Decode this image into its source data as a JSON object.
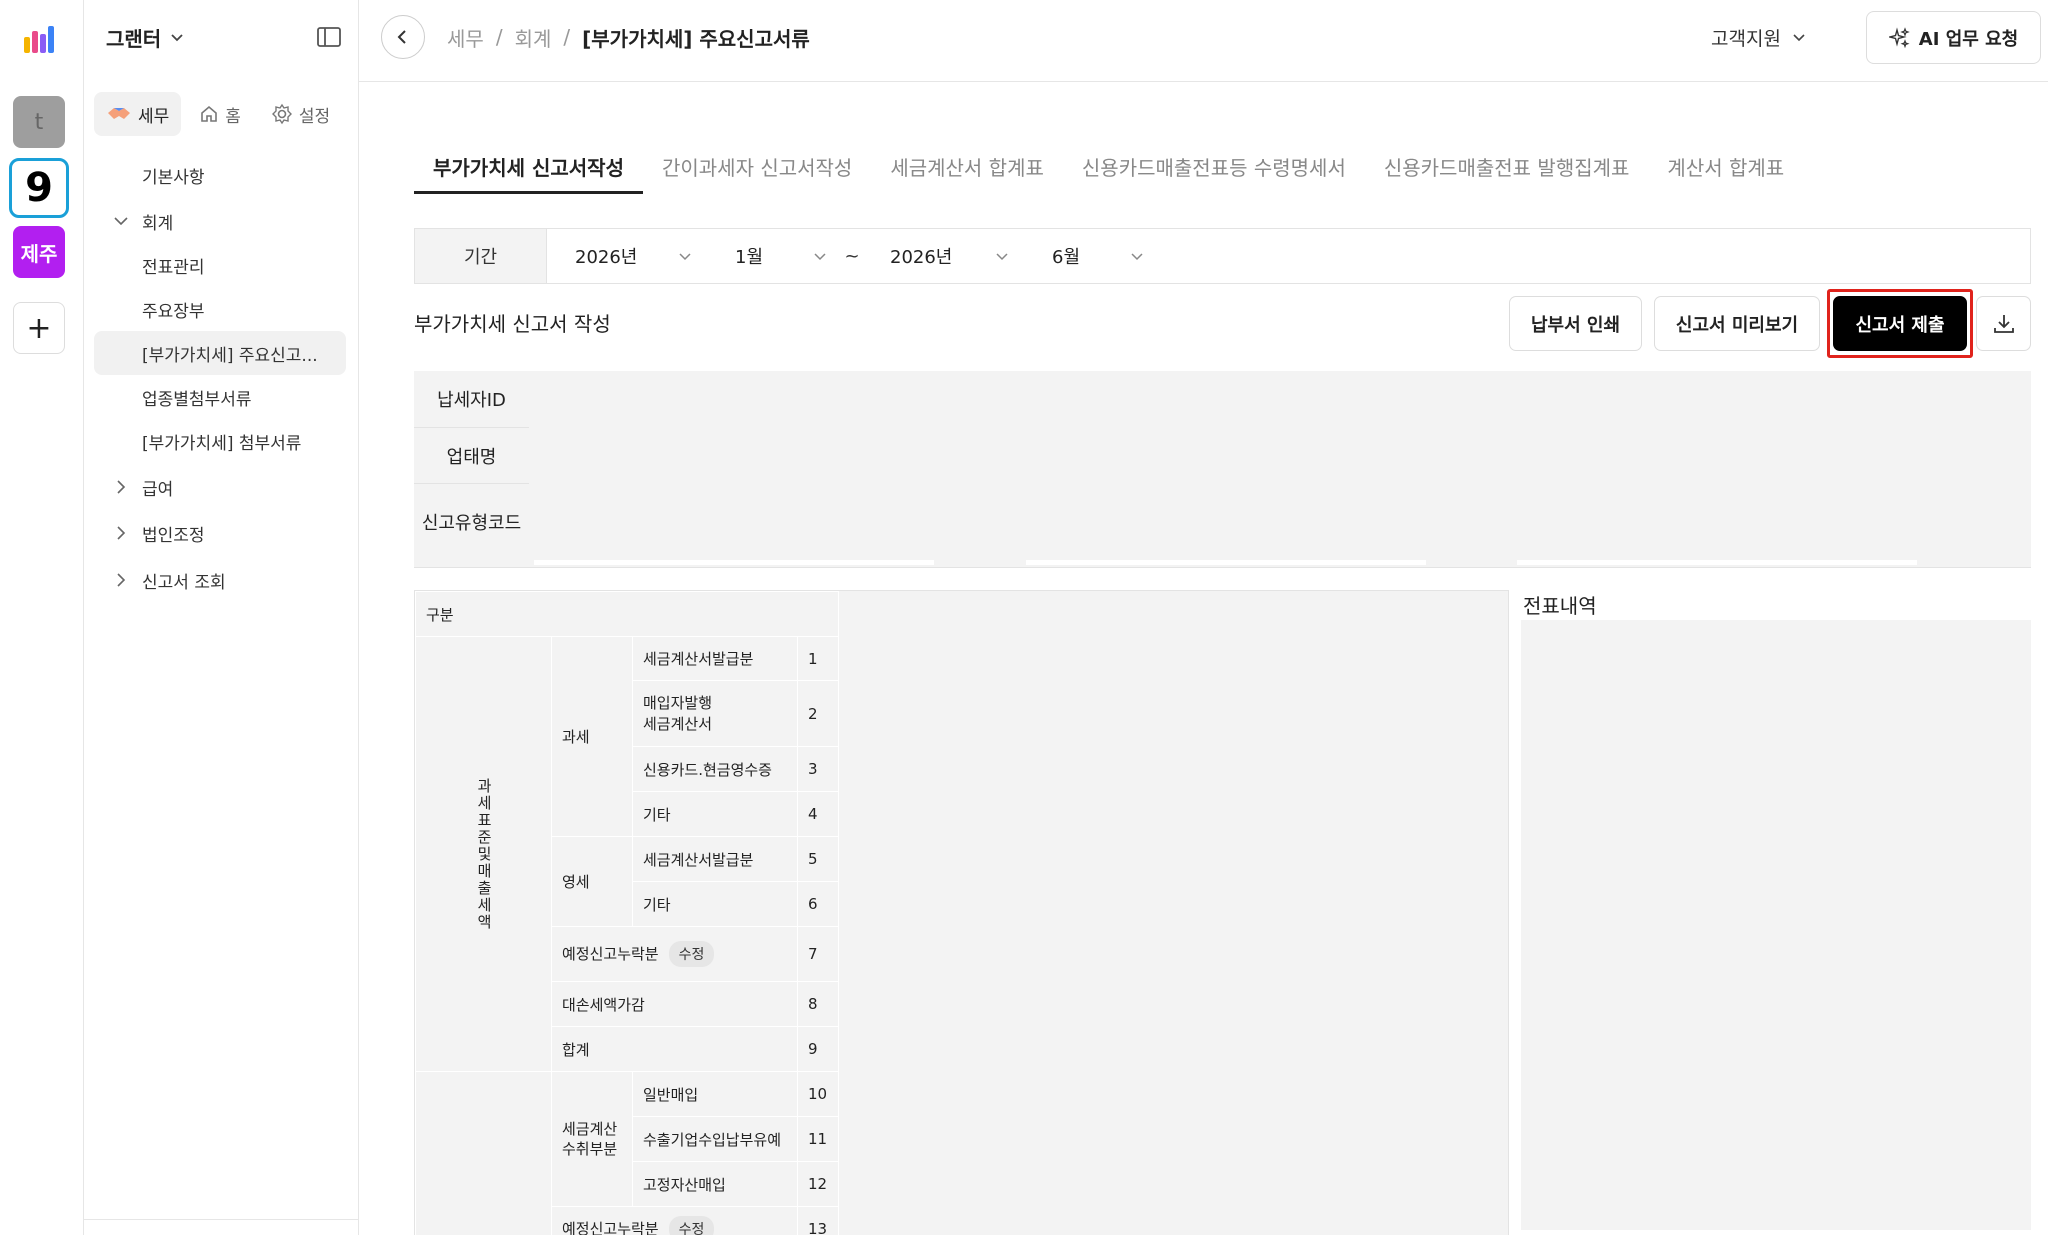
{
  "rail": {
    "tiles": [
      {
        "label": "t"
      },
      {
        "label": "9"
      },
      {
        "label": "제주"
      }
    ],
    "add": "+"
  },
  "sidebar": {
    "company": "그랜터",
    "pills": [
      {
        "label": "세무",
        "icon": "handshake-icon"
      },
      {
        "label": "홈",
        "icon": "home-icon"
      },
      {
        "label": "설정",
        "icon": "gear-icon"
      }
    ],
    "items": [
      {
        "label": "기본사항"
      },
      {
        "label": "회계"
      },
      {
        "label": "전표관리"
      },
      {
        "label": "주요장부"
      },
      {
        "label": "[부가가치세] 주요신고..."
      },
      {
        "label": "업종별첨부서류"
      },
      {
        "label": "[부가가치세] 첨부서류"
      },
      {
        "label": "급여"
      },
      {
        "label": "법인조정"
      },
      {
        "label": "신고서 조회"
      }
    ]
  },
  "header": {
    "breadcrumb": [
      "세무",
      "/",
      "회계",
      "/",
      "[부가가치세] 주요신고서류"
    ],
    "support": "고객지원",
    "ai_button": "AI 업무 요청"
  },
  "tabs": [
    {
      "label": "부가가치세 신고서작성"
    },
    {
      "label": "간이과세자 신고서작성"
    },
    {
      "label": "세금계산서 합계표"
    },
    {
      "label": "신용카드매출전표등 수령명세서"
    },
    {
      "label": "신용카드매출전표 발행집계표"
    },
    {
      "label": "계산서 합계표"
    }
  ],
  "period": {
    "label": "기간",
    "from_year": "2026년",
    "from_month": "1월",
    "separator": "~",
    "to_year": "2026년",
    "to_month": "6월"
  },
  "section": {
    "title": "부가가치세 신고서 작성",
    "buttons": {
      "print": "납부서 인쇄",
      "preview": "신고서 미리보기",
      "submit": "신고서 제출"
    }
  },
  "info_labels": [
    "납세자ID",
    "업태명",
    "신고유형코드"
  ],
  "vat_table": {
    "header": "구분",
    "group1": "과세표준및매출세액",
    "sub_taxable": "과세",
    "sub_zero": "영세",
    "rows": [
      {
        "label": "세금계산서발급분",
        "num": "1"
      },
      {
        "label": "매입자발행\n세금계산서",
        "num": "2"
      },
      {
        "label": "신용카드.현금영수증",
        "num": "3"
      },
      {
        "label": "기타",
        "num": "4"
      },
      {
        "label": "세금계산서발급분",
        "num": "5"
      },
      {
        "label": "기타",
        "num": "6"
      },
      {
        "label": "예정신고누락분",
        "num": "7",
        "badge": "수정"
      },
      {
        "label": "대손세액가감",
        "num": "8"
      },
      {
        "label": "합계",
        "num": "9"
      },
      {
        "label": "일반매입",
        "num": "10"
      },
      {
        "label": "수출기업수입납부유예",
        "num": "11"
      },
      {
        "label": "고정자산매입",
        "num": "12"
      },
      {
        "label": "예정신고누락분",
        "num": "13",
        "badge": "수정"
      }
    ],
    "sub_invoice": "세금계산\n수취부분"
  },
  "journal": {
    "title": "전표내역"
  },
  "colors": {
    "accent": "#000000",
    "highlight": "#e0231c",
    "panel": "#f3f3f3",
    "jeju": "#b21ff0",
    "rail_blue": "#1aa0d8"
  }
}
